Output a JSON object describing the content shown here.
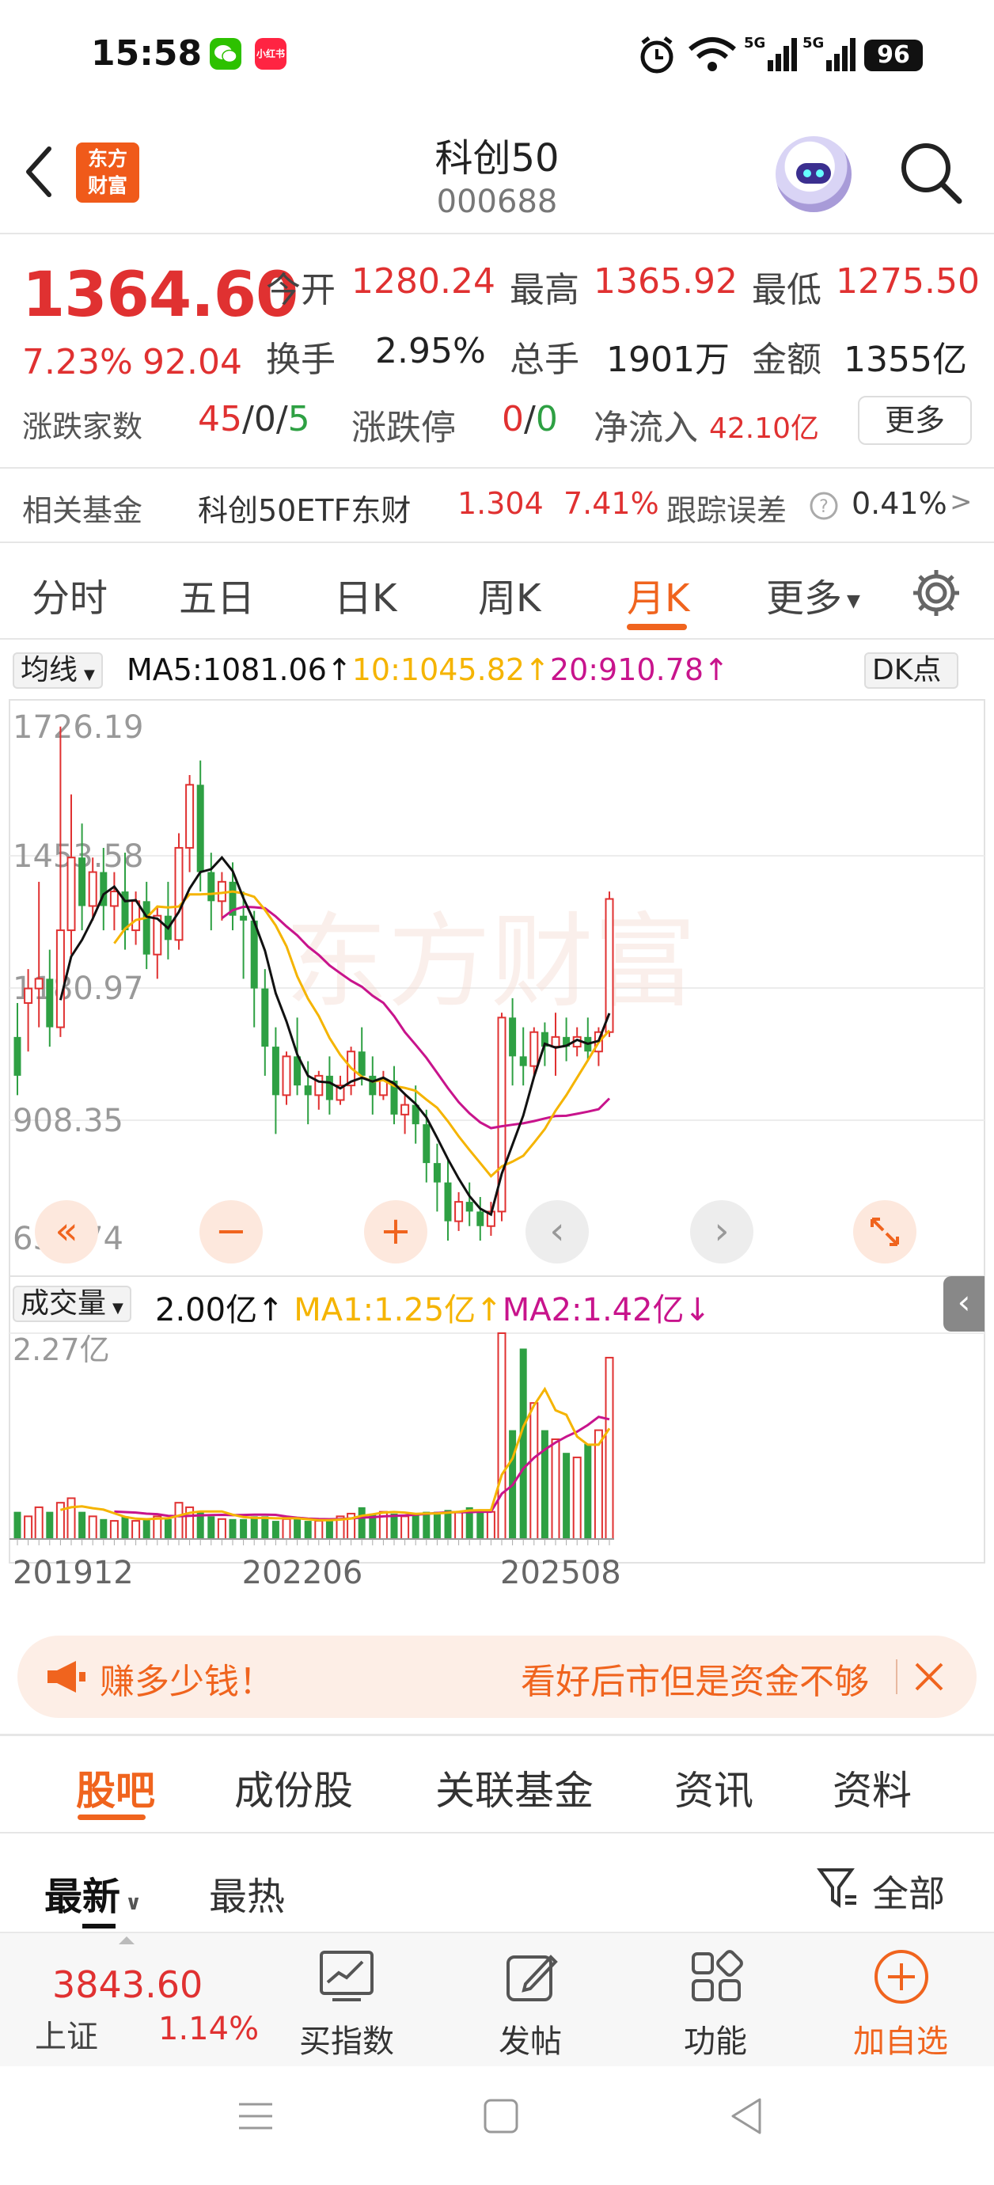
{
  "status_bar": {
    "time": "15:58",
    "battery": "96",
    "network": [
      "5G",
      "5G"
    ],
    "xhs_label": "小红书"
  },
  "header": {
    "logo_line1": "东方",
    "logo_line2": "财富",
    "title": "科创50",
    "code": "000688"
  },
  "quote": {
    "price": "1364.60",
    "change_pct": "7.23%",
    "change": "92.04",
    "open_label": "今开",
    "open": "1280.24",
    "high_label": "最高",
    "high": "1365.92",
    "low_label": "最低",
    "low": "1275.50",
    "turnover_label": "换手",
    "turnover": "2.95%",
    "volume_label": "总手",
    "volume": "1901万",
    "amount_label": "金额",
    "amount": "1355亿",
    "breadth_label": "涨跌家数",
    "breadth_up": "45",
    "breadth_flat": "0",
    "breadth_down": "5",
    "limit_label": "涨跌停",
    "limit_up": "0",
    "limit_down": "0",
    "inflow_label": "净流入",
    "inflow": "42.10亿",
    "more_label": "更多",
    "colors": {
      "up": "#e03131",
      "down": "#2ea043",
      "accent": "#f0641e"
    }
  },
  "fund": {
    "label": "相关基金",
    "name": "科创50ETF东财",
    "price": "1.304",
    "pct": "7.41%",
    "err_label": "跟踪误差",
    "err_value": "0.41%",
    "chevron": ">"
  },
  "chart_tabs": [
    "分时",
    "五日",
    "日K",
    "周K",
    "月K",
    "更多"
  ],
  "chart_tabs_selected": "月K",
  "ma_bar": {
    "selector": "均线",
    "ma5": "MA5:1081.06↑",
    "ma10": "10:1045.82↑",
    "ma20": "20:910.78↑",
    "dk": "DK点"
  },
  "vol_bar": {
    "selector": "成交量",
    "vol": "2.00亿↑",
    "ma1": "MA1:1.25亿↑",
    "ma2": "MA2:1.42亿↓"
  },
  "watermark": "东方财富",
  "chart_data": {
    "type": "candlestick",
    "title": "",
    "y_ticks": [
      "1726.19",
      "1453.58",
      "1180.97",
      "908.35",
      "635.74"
    ],
    "ylim": [
      635.74,
      1726.19
    ],
    "vol_ticks": [
      "2.27亿"
    ],
    "vol_max": 2.27,
    "x_ticks": [
      "201912",
      "202206",
      "202508"
    ],
    "series_names": [
      "MA5",
      "MA10",
      "MA20"
    ],
    "series_colors": {
      "ma5": "#111111",
      "ma10": "#f5b400",
      "ma20": "#c8148c",
      "vol_ma1": "#f5b400",
      "vol_ma2": "#c8148c"
    },
    "candles": [
      [
        1080,
        1150,
        1000,
        960,
        0.3
      ],
      [
        1150,
        1220,
        1180,
        1050,
        0.25
      ],
      [
        1180,
        1400,
        1200,
        1100,
        0.35
      ],
      [
        1200,
        1260,
        1100,
        1060,
        0.3
      ],
      [
        1100,
        1720,
        1300,
        1080,
        0.4
      ],
      [
        1300,
        1580,
        1450,
        1250,
        0.45
      ],
      [
        1450,
        1520,
        1350,
        1300,
        0.3
      ],
      [
        1350,
        1450,
        1420,
        1320,
        0.25
      ],
      [
        1420,
        1470,
        1350,
        1300,
        0.22
      ],
      [
        1350,
        1420,
        1380,
        1300,
        0.2
      ],
      [
        1380,
        1460,
        1300,
        1260,
        0.25
      ],
      [
        1300,
        1380,
        1360,
        1270,
        0.2
      ],
      [
        1360,
        1400,
        1250,
        1220,
        0.22
      ],
      [
        1250,
        1350,
        1330,
        1200,
        0.25
      ],
      [
        1330,
        1400,
        1280,
        1240,
        0.22
      ],
      [
        1280,
        1500,
        1470,
        1260,
        0.4
      ],
      [
        1470,
        1620,
        1600,
        1420,
        0.35
      ],
      [
        1600,
        1650,
        1420,
        1380,
        0.3
      ],
      [
        1420,
        1460,
        1360,
        1300,
        0.25
      ],
      [
        1360,
        1420,
        1400,
        1320,
        0.22
      ],
      [
        1400,
        1440,
        1330,
        1300,
        0.22
      ],
      [
        1330,
        1380,
        1320,
        1200,
        0.22
      ],
      [
        1320,
        1340,
        1180,
        1100,
        0.25
      ],
      [
        1180,
        1220,
        1060,
        1000,
        0.25
      ],
      [
        1060,
        1100,
        960,
        880,
        0.2
      ],
      [
        960,
        1050,
        1040,
        940,
        0.22
      ],
      [
        1040,
        1120,
        980,
        960,
        0.22
      ],
      [
        980,
        1030,
        960,
        900,
        0.2
      ],
      [
        960,
        1010,
        1000,
        930,
        0.2
      ],
      [
        1000,
        1040,
        950,
        920,
        0.2
      ],
      [
        950,
        1000,
        980,
        940,
        0.25
      ],
      [
        980,
        1060,
        1050,
        960,
        0.28
      ],
      [
        1050,
        1100,
        1000,
        980,
        0.35
      ],
      [
        1000,
        1040,
        960,
        920,
        0.28
      ],
      [
        960,
        1010,
        990,
        950,
        0.3
      ],
      [
        990,
        1020,
        920,
        900,
        0.28
      ],
      [
        920,
        960,
        940,
        880,
        0.25
      ],
      [
        940,
        980,
        900,
        860,
        0.28
      ],
      [
        900,
        930,
        820,
        780,
        0.3
      ],
      [
        820,
        860,
        780,
        720,
        0.3
      ],
      [
        780,
        830,
        700,
        660,
        0.32
      ],
      [
        700,
        760,
        740,
        680,
        0.3
      ],
      [
        740,
        780,
        720,
        690,
        0.35
      ],
      [
        720,
        750,
        690,
        660,
        0.32
      ],
      [
        690,
        740,
        720,
        670,
        0.3
      ],
      [
        720,
        1130,
        1120,
        700,
        2.27
      ],
      [
        1120,
        1160,
        1040,
        980,
        1.2
      ],
      [
        1040,
        1100,
        1020,
        980,
        2.1
      ],
      [
        1020,
        1100,
        1090,
        1000,
        1.5
      ],
      [
        1090,
        1110,
        1060,
        1020,
        1.2
      ],
      [
        1060,
        1130,
        1080,
        1000,
        1.1
      ],
      [
        1080,
        1120,
        1060,
        1030,
        0.95
      ],
      [
        1060,
        1100,
        1080,
        1040,
        0.9
      ],
      [
        1080,
        1120,
        1050,
        1030,
        1.05
      ],
      [
        1050,
        1100,
        1090,
        1020,
        1.2
      ],
      [
        1090,
        1380,
        1364.6,
        1080,
        2.0
      ]
    ]
  },
  "ticker": {
    "left_text": "赚多少钱！",
    "right_text": "看好后市但是资金不够"
  },
  "bottom_tabs": [
    "股吧",
    "成份股",
    "关联基金",
    "资讯",
    "资料"
  ],
  "bottom_tabs_selected": "股吧",
  "sort": {
    "latest": "最新",
    "hot": "最热",
    "all": "全部"
  },
  "bottom_bar": {
    "index_value": "3843.60",
    "index_name": "上证",
    "index_pct": "1.14%",
    "btn1": "买指数",
    "btn2": "发帖",
    "btn3": "功能",
    "btn4": "加自选"
  }
}
